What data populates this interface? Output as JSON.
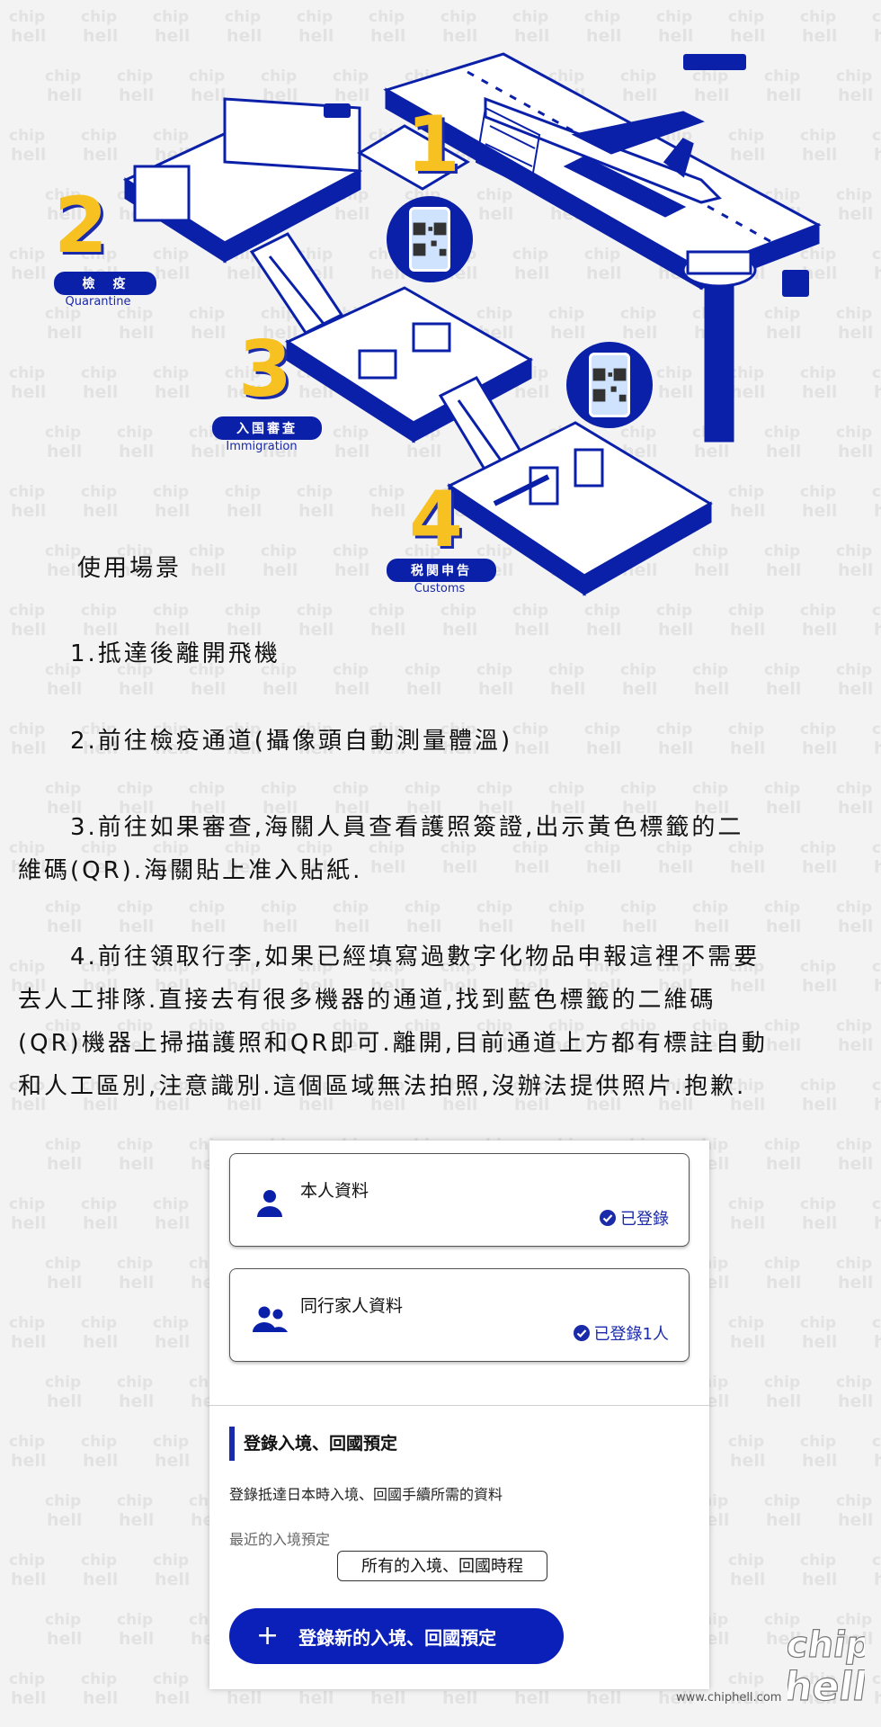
{
  "illustration": {
    "stages": [
      {
        "number": "1"
      },
      {
        "number": "2",
        "label": "檢　疫",
        "label_en": "Quarantine"
      },
      {
        "number": "3",
        "label": "入国審査",
        "label_en": "Immigration"
      },
      {
        "number": "4",
        "label": "税関申告",
        "label_en": "Customs"
      }
    ],
    "colors": {
      "accent_blue": "#0b20a8",
      "number_yellow": "#f7c221"
    }
  },
  "article": {
    "heading": "使用場景",
    "items": [
      {
        "lines": [
          "　　1.抵達後離開飛機"
        ]
      },
      {
        "lines": [
          "　　2.前往檢疫通道(攝像頭自動測量體溫)"
        ]
      },
      {
        "lines": [
          "　　3.前往如果審查,海關人員查看護照簽證,出示黃色標籤的二",
          "維碼(QR).海關貼上准入貼紙."
        ]
      },
      {
        "lines": [
          "　　4.前往領取行李,如果已經填寫過數字化物品申報這裡不需要",
          "去人工排隊.直接去有很多機器的通道,找到藍色標籤的二維碼",
          "(QR)機器上掃描護照和QR即可.離開,目前通道上方都有標註自動",
          "和人工區別,注意識別.這個區域無法拍照,沒辦法提供照片.抱歉."
        ]
      }
    ]
  },
  "app": {
    "cards": [
      {
        "title": "本人資料",
        "status": "已登錄",
        "icon": "person-icon"
      },
      {
        "title": "同行家人資料",
        "status": "已登錄1人",
        "icon": "group-icon"
      }
    ],
    "section_title": "登錄入境、回國預定",
    "section_desc": "登錄抵達日本時入境、回國手續所需的資料",
    "recent_label": "最近的入境預定",
    "all_schedules_label": "所有的入境、回國時程",
    "new_button_label": "登錄新的入境、回國預定",
    "new_button_icon": "+",
    "colors": {
      "primary": "#0b20b8",
      "status": "#1a2aa8"
    }
  },
  "footer": {
    "logo_text": "chip hell",
    "site_url": "www.chiphell.com"
  }
}
